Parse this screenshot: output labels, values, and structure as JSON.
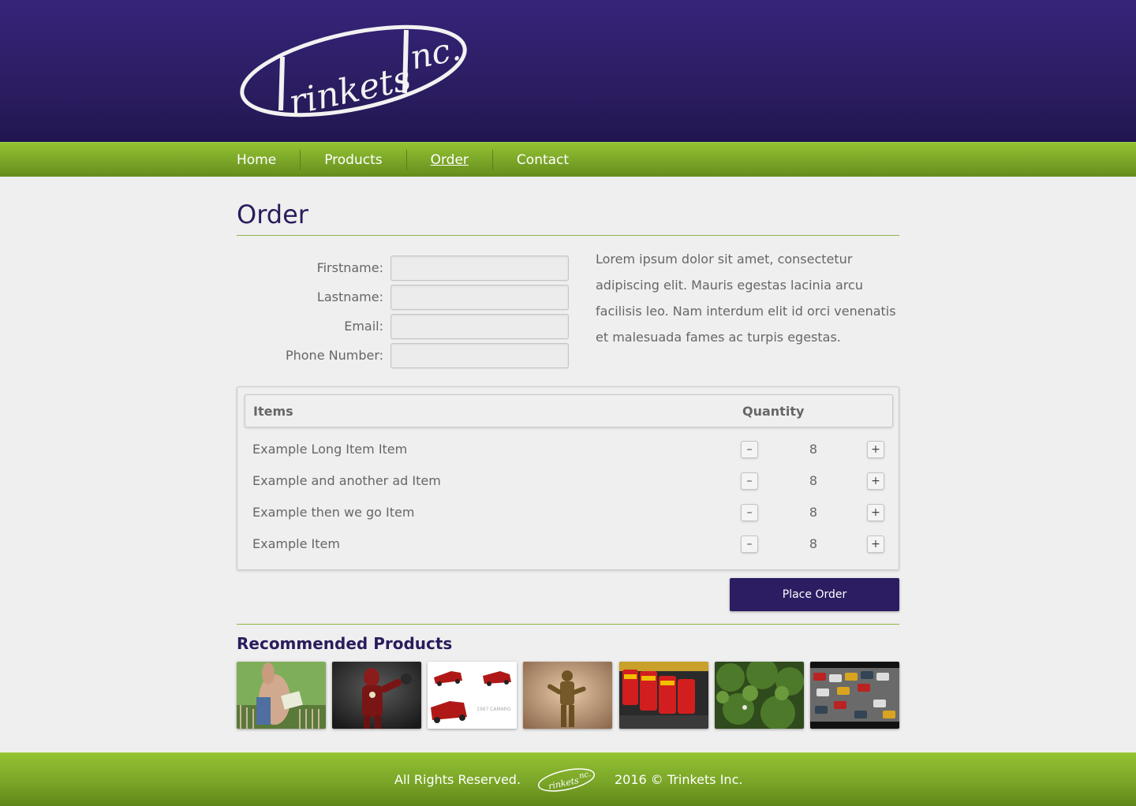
{
  "brand": {
    "logo_text": "trinkets Inc."
  },
  "nav": {
    "items": [
      {
        "label": "Home"
      },
      {
        "label": "Products"
      },
      {
        "label": "Order"
      },
      {
        "label": "Contact"
      }
    ],
    "active_index": 2
  },
  "page": {
    "title": "Order"
  },
  "form": {
    "firstname_label": "Firstname:",
    "lastname_label": "Lastname:",
    "email_label": "Email:",
    "phone_label": "Phone Number:",
    "firstname_value": "",
    "lastname_value": "",
    "email_value": "",
    "phone_value": ""
  },
  "intro": {
    "text": "Lorem ipsum dolor sit amet, consectetur adipiscing elit. Mauris egestas lacinia arcu facilisis leo. Nam interdum elit id orci venenatis et malesuada fames ac turpis egestas."
  },
  "items_table": {
    "col_items": "Items",
    "col_quantity": "Quantity",
    "minus_label": "–",
    "plus_label": "+",
    "rows": [
      {
        "name": "Example Long Item Item",
        "qty": "8"
      },
      {
        "name": "Example and another ad Item",
        "qty": "8"
      },
      {
        "name": "Example then we go Item",
        "qty": "8"
      },
      {
        "name": "Example Item",
        "qty": "8"
      }
    ]
  },
  "order_button": {
    "label": "Place Order"
  },
  "recommended": {
    "title": "Recommended Products",
    "products": [
      {
        "image": "toy-deer-with-book"
      },
      {
        "image": "iron-man-figure"
      },
      {
        "image": "toy-camaro-cars",
        "caption": "1967 CAMARO"
      },
      {
        "image": "toy-soldier-figure"
      },
      {
        "image": "red-toy-trucks"
      },
      {
        "image": "green-foliage"
      },
      {
        "image": "toy-car-traffic"
      }
    ]
  },
  "footer": {
    "left": "All Rights Reserved.",
    "right": "2016 © Trinkets Inc."
  },
  "colors": {
    "header_purple": "#2c1d62",
    "nav_green": "#7aa528",
    "title_purple": "#2a1c5c",
    "text_gray": "#666666"
  }
}
